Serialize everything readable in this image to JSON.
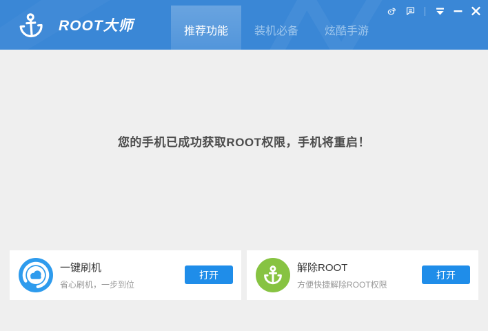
{
  "app": {
    "title": "ROOT大师",
    "logo_icon": "anchor-icon"
  },
  "header": {
    "tabs": [
      {
        "label": "推荐功能",
        "active": true
      },
      {
        "label": "装机必备",
        "active": false
      },
      {
        "label": "炫酷手游",
        "active": false
      }
    ],
    "controls": [
      {
        "icon": "weibo-icon"
      },
      {
        "icon": "feedback-chat-icon"
      },
      {
        "icon": "collapse-menu-icon"
      },
      {
        "icon": "minimize-icon"
      },
      {
        "icon": "close-icon"
      }
    ]
  },
  "main": {
    "message": "您的手机已成功获取ROOT权限，手机将重启！"
  },
  "cards": [
    {
      "icon": "cloud-flash-icon",
      "icon_color": "#2e9bed",
      "title": "一键刷机",
      "subtitle": "省心刷机，一步到位",
      "button": "打开"
    },
    {
      "icon": "unroot-anchor-icon",
      "icon_color": "#87c342",
      "title": "解除ROOT",
      "subtitle": "方便快捷解除ROOT权限",
      "button": "打开"
    }
  ],
  "colors": {
    "header_blue": "#3a87d6",
    "accent_blue": "#1f8de9",
    "content_bg": "#efefef",
    "card_bg": "#ffffff",
    "message_text": "#4d4d4d",
    "inactive_tab_text": "#9ec6ec",
    "cloud_icon_blue": "#2e9bed",
    "unroot_icon_green": "#87c342"
  }
}
